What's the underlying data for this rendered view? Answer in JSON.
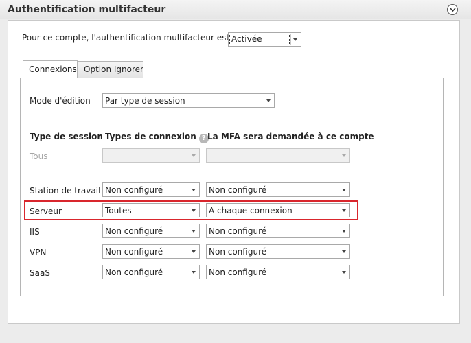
{
  "header": {
    "title": "Authentification multifacteur"
  },
  "intro": {
    "label": "Pour ce compte, l'authentification multifacteur est",
    "mfa_state": "Activée"
  },
  "tabs": [
    {
      "label": "Connexions",
      "active": true
    },
    {
      "label": "Option Ignorer",
      "active": false
    }
  ],
  "edit_mode": {
    "label": "Mode d'édition",
    "value": "Par type de session"
  },
  "columns": {
    "session_type": "Type de session",
    "connection_types": "Types de connexion",
    "mfa_required": "La MFA sera demandée à ce compte"
  },
  "rows": [
    {
      "name": "Tous",
      "connection": "",
      "mfa": "",
      "disabled": true
    },
    {
      "name": "Station de travail",
      "connection": "Non configuré",
      "mfa": "Non configuré"
    },
    {
      "name": "Serveur",
      "connection": "Toutes",
      "mfa": "A chaque connexion",
      "highlighted": true
    },
    {
      "name": "IIS",
      "connection": "Non configuré",
      "mfa": "Non configuré"
    },
    {
      "name": "VPN",
      "connection": "Non configuré",
      "mfa": "Non configuré"
    },
    {
      "name": "SaaS",
      "connection": "Non configuré",
      "mfa": "Non configuré"
    }
  ],
  "colors": {
    "highlight": "#d9262d",
    "disabled_text": "#a6a6a6"
  }
}
